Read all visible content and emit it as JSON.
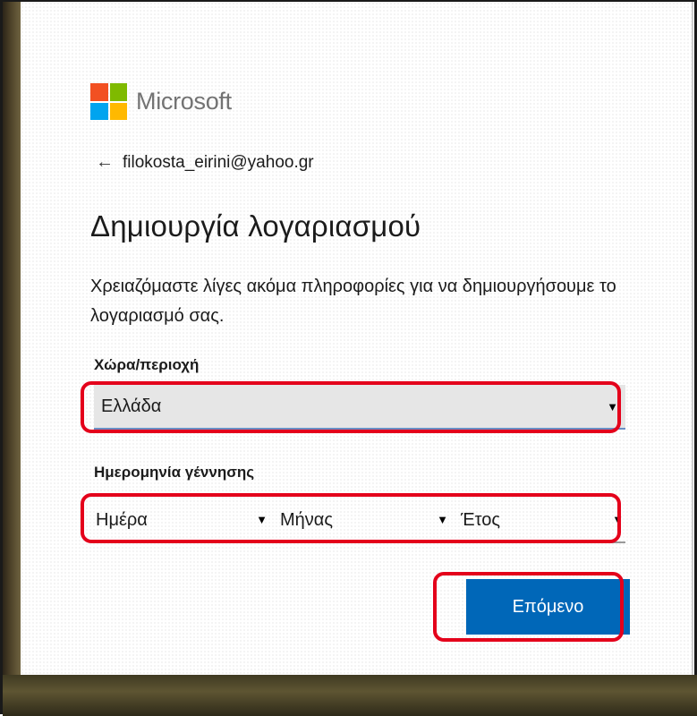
{
  "brand": {
    "name": "Microsoft",
    "logo_colors": [
      "#f25022",
      "#7fba00",
      "#00a4ef",
      "#ffb900"
    ]
  },
  "back": {
    "icon": "back-arrow-icon",
    "arrow": "←",
    "email": "filokosta_eirini@yahoo.gr"
  },
  "page": {
    "title": "Δημιουργία λογαριασμού",
    "description": "Χρειαζόμαστε λίγες ακόμα πληροφορίες για να δημιουργήσουμε το λογαριασμό σας."
  },
  "country": {
    "label": "Χώρα/περιοχή",
    "value": "Ελλάδα"
  },
  "birthdate": {
    "label": "Ημερομηνία γέννησης",
    "day": "Ημέρα",
    "month": "Μήνας",
    "year": "Έτος"
  },
  "caret": "▼",
  "next_button": {
    "label": "Επόμενο",
    "color": "#0067b8"
  },
  "highlight_color": "#e4001b"
}
